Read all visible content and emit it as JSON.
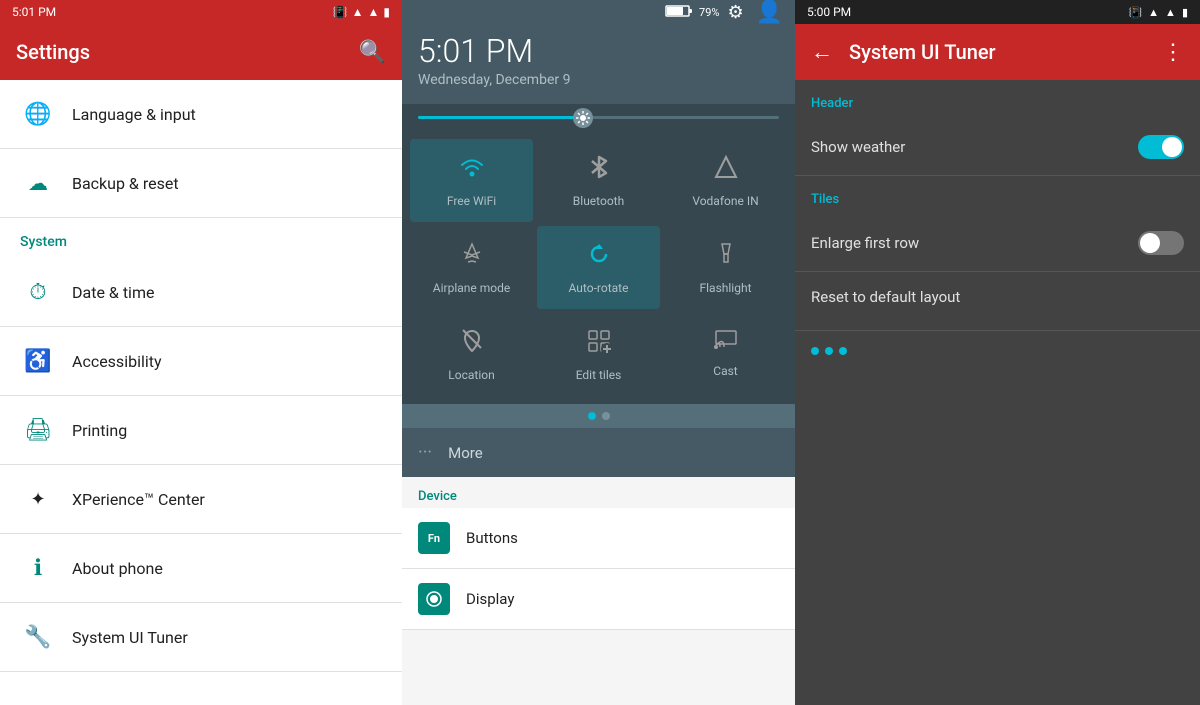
{
  "panel1": {
    "statusBar": {
      "time": "5:01 PM"
    },
    "header": {
      "title": "Settings"
    },
    "systemSection": "System",
    "items": [
      {
        "icon": "🌐",
        "label": "Language & input"
      },
      {
        "icon": "☁",
        "label": "Backup & reset"
      }
    ],
    "systemItems": [
      {
        "icon": "⏰",
        "label": "Date & time"
      },
      {
        "icon": "♿",
        "label": "Accessibility"
      },
      {
        "icon": "🖨",
        "label": "Printing"
      },
      {
        "icon": "✦",
        "label": "XPerience™ Center"
      },
      {
        "icon": "ℹ",
        "label": "About phone"
      },
      {
        "icon": "🔧",
        "label": "System UI Tuner"
      }
    ]
  },
  "panel2": {
    "statusBar": {
      "battery": "79%"
    },
    "time": "5:01 PM",
    "date": "Wednesday, December 9",
    "tiles": [
      {
        "label": "Free WiFi",
        "active": true,
        "icon": "wifi"
      },
      {
        "label": "Bluetooth",
        "active": false,
        "icon": "bluetooth"
      },
      {
        "label": "Vodafone IN",
        "active": false,
        "icon": "signal"
      },
      {
        "label": "Airplane mode",
        "active": false,
        "icon": "airplane"
      },
      {
        "label": "Auto-rotate",
        "active": true,
        "icon": "rotate"
      },
      {
        "label": "Flashlight",
        "active": false,
        "icon": "flashlight"
      },
      {
        "label": "Location",
        "active": false,
        "icon": "location"
      },
      {
        "label": "Edit tiles",
        "active": false,
        "icon": "edit"
      },
      {
        "label": "Cast",
        "active": false,
        "icon": "cast"
      }
    ],
    "more": "More",
    "deviceSection": "Device",
    "deviceItems": [
      {
        "icon": "Fn",
        "label": "Buttons"
      },
      {
        "icon": "◉",
        "label": "Display"
      }
    ]
  },
  "panel3": {
    "statusBar": {
      "time": "5:00 PM"
    },
    "header": {
      "title": "System UI Tuner"
    },
    "headerSection": "Header",
    "showWeather": "Show weather",
    "tilesSection": "Tiles",
    "enlargeFirstRow": "Enlarge first row",
    "resetLayout": "Reset to default layout"
  }
}
